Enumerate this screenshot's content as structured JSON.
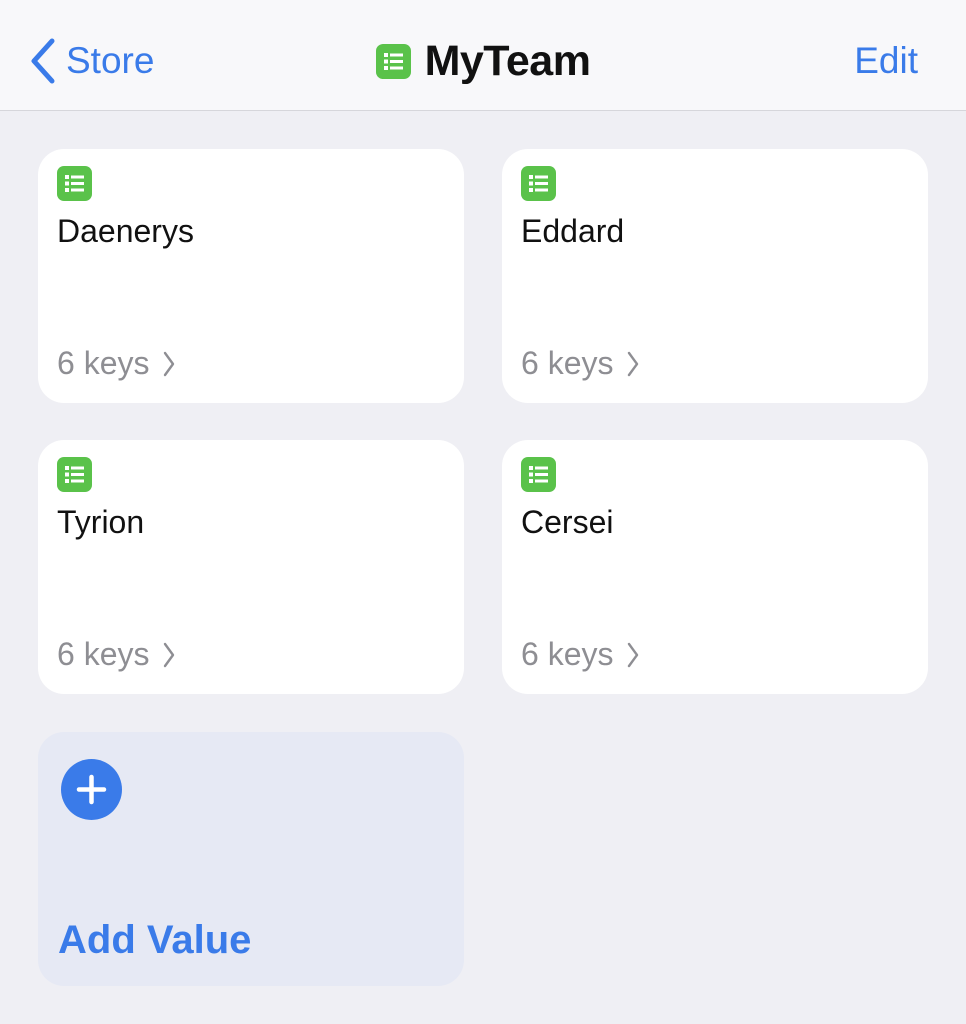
{
  "nav": {
    "back_label": "Store",
    "title": "MyTeam",
    "edit_label": "Edit",
    "title_icon": "spreadsheet-icon"
  },
  "cards": [
    {
      "name": "Daenerys",
      "keys_label": "6 keys",
      "icon": "spreadsheet-icon"
    },
    {
      "name": "Eddard",
      "keys_label": "6 keys",
      "icon": "spreadsheet-icon"
    },
    {
      "name": "Tyrion",
      "keys_label": "6 keys",
      "icon": "spreadsheet-icon"
    },
    {
      "name": "Cersei",
      "keys_label": "6 keys",
      "icon": "spreadsheet-icon"
    }
  ],
  "add_card": {
    "label": "Add Value",
    "icon": "plus-circle-icon"
  },
  "colors": {
    "accent": "#3a7be9",
    "icon_green": "#5ac24a",
    "background": "#efeff4",
    "card": "#ffffff",
    "add_card": "#e6e9f4",
    "secondary_text": "#8e8e93"
  }
}
